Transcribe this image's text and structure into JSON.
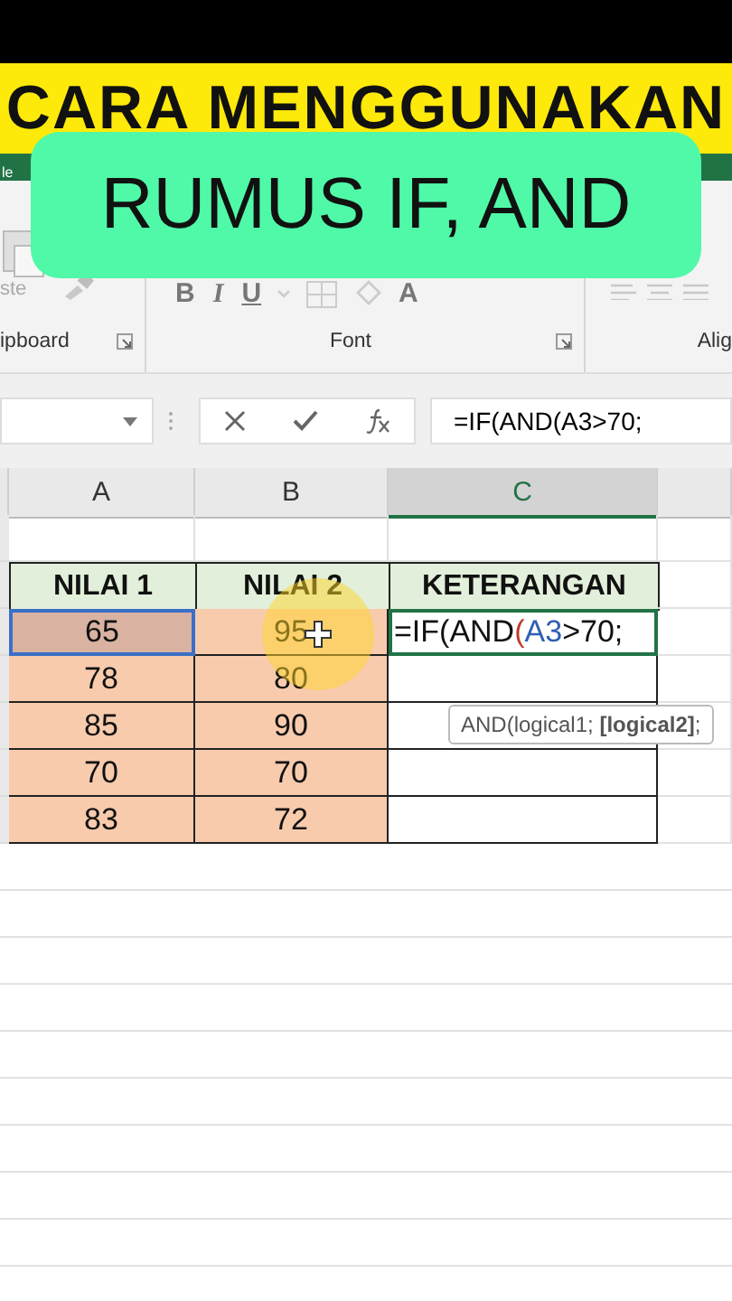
{
  "banner": {
    "title": "CARA MENGGUNAKAN",
    "subtitle": "RUMUS IF, AND"
  },
  "ribbon": {
    "tab_fragment": "le",
    "paste_label": "ste",
    "groups": [
      {
        "label": "ipboard",
        "kind": "clipboard"
      },
      {
        "label": "Font",
        "kind": "font"
      },
      {
        "label": "Alig",
        "kind": "alignment"
      }
    ]
  },
  "font_buttons": [
    {
      "label": "B",
      "kind": "bold"
    },
    {
      "label": "I",
      "kind": "italic"
    },
    {
      "label": "U",
      "kind": "underline"
    },
    {
      "label": "A",
      "kind": "color"
    }
  ],
  "formula_bar": {
    "formula": "=IF(AND(A3>70;"
  },
  "columns": [
    {
      "label": "A",
      "selected": false
    },
    {
      "label": "B",
      "selected": false
    },
    {
      "label": "C",
      "selected": true
    }
  ],
  "table": {
    "headers": [
      "NILAI 1",
      "NILAI 2",
      "KETERANGAN"
    ],
    "rows": [
      {
        "cells": [
          {
            "text": "65",
            "selected": true
          },
          {
            "text": "95",
            "selected": false
          }
        ],
        "keterangan": [
          {
            "text": "=IF(AND",
            "kind": "plain"
          },
          {
            "text": "(",
            "kind": "paren"
          },
          {
            "text": "A3",
            "kind": "ref"
          },
          {
            "text": ">70;",
            "kind": "plain"
          }
        ]
      },
      {
        "cells": [
          {
            "text": "78",
            "selected": false
          },
          {
            "text": "80",
            "selected": false
          }
        ]
      },
      {
        "cells": [
          {
            "text": "85",
            "selected": false
          },
          {
            "text": "90",
            "selected": false
          }
        ]
      },
      {
        "cells": [
          {
            "text": "70",
            "selected": false
          },
          {
            "text": "70",
            "selected": false
          }
        ]
      },
      {
        "cells": [
          {
            "text": "83",
            "selected": false
          },
          {
            "text": "72",
            "selected": false
          }
        ]
      }
    ]
  },
  "tooltip": "AND(logical1; **[logical2]**;"
}
